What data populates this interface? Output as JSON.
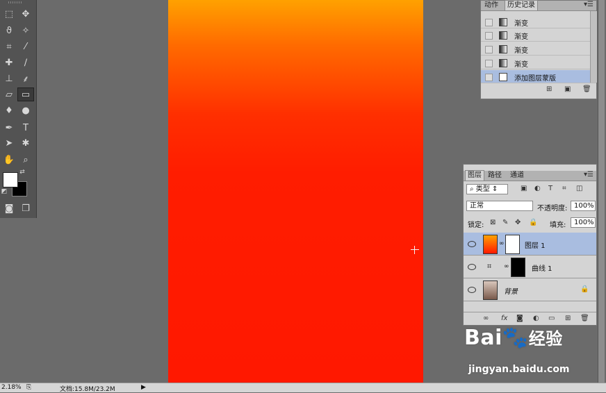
{
  "colors": {
    "workspace": "#6b6b6b",
    "gradient_top": "#ffa100",
    "gradient_bottom": "#ff1800",
    "selection": "#a9bde0"
  },
  "history_panel": {
    "tabs": [
      "动作",
      "历史记录"
    ],
    "items": [
      {
        "label": "渐变"
      },
      {
        "label": "渐变"
      },
      {
        "label": "渐变"
      },
      {
        "label": "渐变"
      },
      {
        "label": "添加图层蒙版"
      }
    ]
  },
  "layers_panel": {
    "tabs": [
      "图层",
      "路径",
      "通道"
    ],
    "filter_label": "类型",
    "blend_mode": "正常",
    "opacity_label": "不透明度:",
    "opacity_value": "100%",
    "lock_label": "锁定:",
    "fill_label": "填充:",
    "fill_value": "100%",
    "layers": [
      {
        "name": "图层 1"
      },
      {
        "name": "曲线 1"
      },
      {
        "name": "背景"
      }
    ],
    "footer_icons": [
      "link-icon",
      "fx-icon",
      "mask-icon",
      "adjustment-icon",
      "folder-icon",
      "new-layer-icon",
      "trash-icon"
    ]
  },
  "status_bar": {
    "zoom": "2.18%",
    "doc_info": "文档:15.8M/23.2M"
  },
  "watermark": {
    "brand": "Bai",
    "brand_cn": "经验",
    "url": "jingyan.baidu.com"
  }
}
